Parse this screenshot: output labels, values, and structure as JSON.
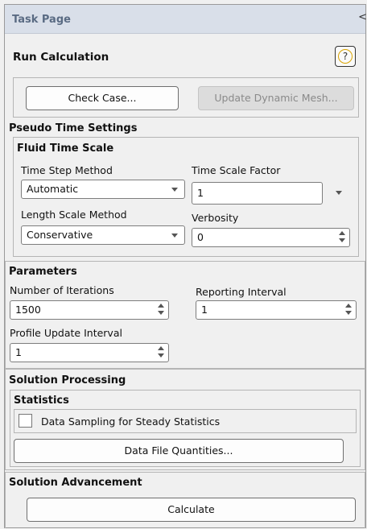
{
  "panel": {
    "title": "Task Page",
    "corner_glyph": "<"
  },
  "header": {
    "title": "Run Calculation",
    "help_glyph": "?",
    "help_icon": "help-icon"
  },
  "buttons": {
    "check_case": "Check Case...",
    "update_dynamic_mesh": "Update Dynamic Mesh..."
  },
  "pseudo_time": {
    "title": "Pseudo Time Settings",
    "fluid_time_scale": {
      "title": "Fluid Time Scale",
      "time_step_method": {
        "label": "Time Step Method",
        "value": "Automatic"
      },
      "time_scale_factor": {
        "label": "Time Scale Factor",
        "value": "1"
      },
      "length_scale_method": {
        "label": "Length Scale Method",
        "value": "Conservative"
      },
      "verbosity": {
        "label": "Verbosity",
        "value": "0"
      }
    }
  },
  "parameters": {
    "title": "Parameters",
    "number_of_iterations": {
      "label": "Number of Iterations",
      "value": "1500"
    },
    "reporting_interval": {
      "label": "Reporting Interval",
      "value": "1"
    },
    "profile_update_interval": {
      "label": "Profile Update Interval",
      "value": "1"
    }
  },
  "solution_processing": {
    "title": "Solution Processing",
    "statistics": {
      "title": "Statistics",
      "data_sampling_label": "Data Sampling for Steady Statistics",
      "data_sampling_checked": false
    },
    "data_file_quantities": "Data File Quantities..."
  },
  "solution_advancement": {
    "title": "Solution Advancement",
    "calculate": "Calculate"
  },
  "colors": {
    "titlebar_bg": "#d9dfe9",
    "title_text": "#5a6b83",
    "help_ring": "#d9a300"
  }
}
